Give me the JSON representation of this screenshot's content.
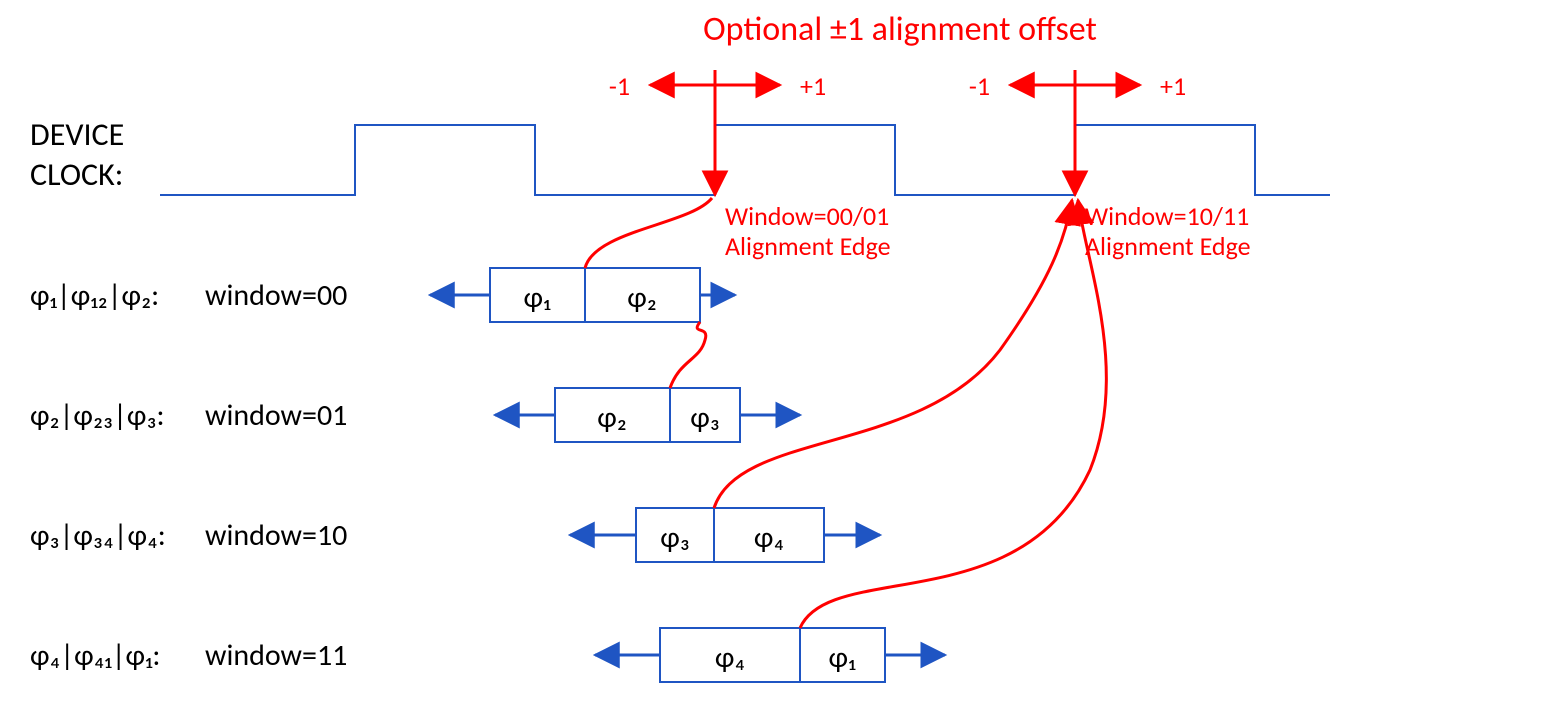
{
  "title": "Optional ±1 alignment offset",
  "offset_left": "-1",
  "offset_right": "+1",
  "clock_label1": "DEVICE",
  "clock_label2": "CLOCK:",
  "edge_labels": {
    "left1": "Window=00/01",
    "left2": "Alignment Edge",
    "right1": "Window=10/11",
    "right2": "Alignment Edge"
  },
  "rows": [
    {
      "label_phis": "φ₁|φ₁₂|φ₂:",
      "label_win": "window=00",
      "box_left": "φ₁",
      "box_right": "φ₂"
    },
    {
      "label_phis": "φ₂|φ₂₃|φ₃:",
      "label_win": "window=01",
      "box_left": "φ₂",
      "box_right": "φ₃"
    },
    {
      "label_phis": "φ₃|φ₃₄|φ₄:",
      "label_win": "window=10",
      "box_left": "φ₃",
      "box_right": "φ₄"
    },
    {
      "label_phis": "φ₄|φ₄₁|φ₁:",
      "label_win": "window=11",
      "box_left": "φ₄",
      "box_right": "φ₁"
    }
  ],
  "chart_data": {
    "type": "diagram",
    "description": "Timing diagram showing DEVICE CLOCK square wave and four phase-window alignment options (00,01,10,11). Each window row shows a two-phase box (φᵢ,φᵢ₊₁) positioned along the clock; the rising clock edge used for alignment depends on the window value (00/01 → first shown rising edge, 10/11 → next rising edge). Optional ±1 alignment offset can shift the alignment point left (-1) or right (+1) around the chosen edge.",
    "windows": [
      {
        "code": "00",
        "phases": [
          "φ1",
          "φ12",
          "φ2"
        ],
        "box": [
          "φ1",
          "φ2"
        ],
        "alignment_edge_group": "00/01"
      },
      {
        "code": "01",
        "phases": [
          "φ2",
          "φ23",
          "φ3"
        ],
        "box": [
          "φ2",
          "φ3"
        ],
        "alignment_edge_group": "00/01"
      },
      {
        "code": "10",
        "phases": [
          "φ3",
          "φ34",
          "φ4"
        ],
        "box": [
          "φ3",
          "φ4"
        ],
        "alignment_edge_group": "10/11"
      },
      {
        "code": "11",
        "phases": [
          "φ4",
          "φ41",
          "φ1"
        ],
        "box": [
          "φ4",
          "φ1"
        ],
        "alignment_edge_group": "10/11"
      }
    ],
    "alignment_offset_values": [
      -1,
      1
    ]
  }
}
